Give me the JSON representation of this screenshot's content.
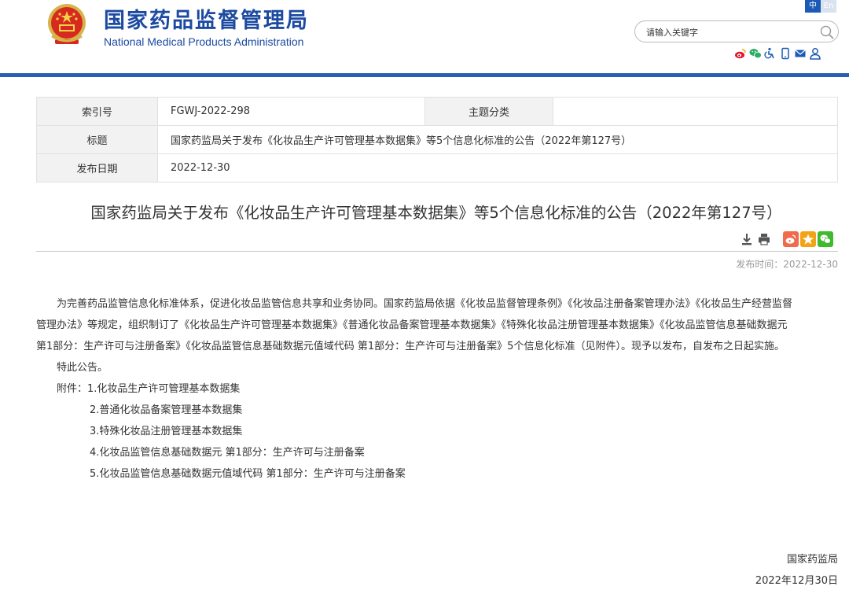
{
  "header": {
    "site_title_cn": "国家药品监督管理局",
    "site_title_en": "National Medical Products Administration",
    "lang_cn": "中",
    "lang_en": "En",
    "search_placeholder": "请输入关键字",
    "brand_color": "#1b4aa0",
    "util_icons": [
      "weibo-icon",
      "wechat-icon",
      "accessibility-icon",
      "mobile-icon",
      "mail-icon",
      "user-icon"
    ]
  },
  "info": {
    "index_label": "索引号",
    "index_value": "FGWJ-2022-298",
    "topic_label": "主题分类",
    "topic_value": "",
    "title_label": "标题",
    "title_value": "国家药监局关于发布《化妆品生产许可管理基本数据集》等5个信息化标准的公告（2022年第127号）",
    "date_label": "发布日期",
    "date_value": "2022-12-30"
  },
  "article": {
    "title": "国家药监局关于发布《化妆品生产许可管理基本数据集》等5个信息化标准的公告（2022年第127号）",
    "publish_label": "发布时间：",
    "publish_value": "2022-12-30",
    "body_line1": "为完善药品监管信息化标准体系，促进化妆品监管信息共享和业务协同。国家药监局依据《化妆品监督管理条例》《化妆品注册备案管理办法》《化妆品生产经营监督",
    "body_line2": "管理办法》等规定，组织制订了《化妆品生产许可管理基本数据集》《普通化妆品备案管理基本数据集》《特殊化妆品注册管理基本数据集》《化妆品监管信息基础数据元",
    "body_line3": "第1部分：生产许可与注册备案》《化妆品监管信息基础数据元值域代码 第1部分：生产许可与注册备案》5个信息化标准（见附件）。现予以发布，自发布之日起实施。",
    "notice": "特此公告。",
    "attachments_label": "附件：",
    "attachments": [
      "1.化妆品生产许可管理基本数据集",
      "2.普通化妆品备案管理基本数据集",
      "3.特殊化妆品注册管理基本数据集",
      "4.化妆品监管信息基础数据元 第1部分：生产许可与注册备案",
      "5.化妆品监管信息基础数据元值域代码 第1部分：生产许可与注册备案"
    ],
    "signature": "国家药监局",
    "sign_date": "2022年12月30日"
  }
}
